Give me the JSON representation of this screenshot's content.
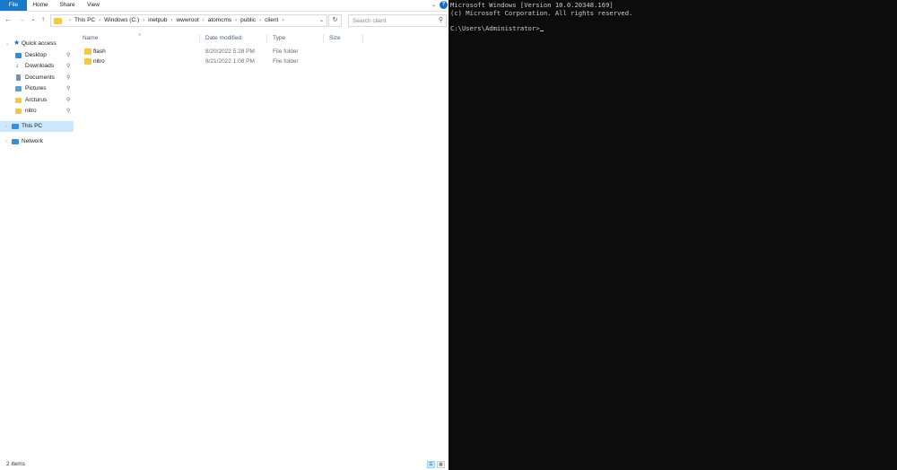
{
  "ribbon": {
    "tabs": [
      "File",
      "Home",
      "Share",
      "View"
    ],
    "help": "?"
  },
  "nav": {
    "address_crumbs": [
      "This PC",
      "Windows (C:)",
      "inetpub",
      "wwwroot",
      "atomcms",
      "public",
      "client"
    ],
    "search_placeholder": "Search client"
  },
  "sidebar": {
    "items": [
      {
        "label": "Quick access",
        "icon": "star-icon",
        "color": "#1a6fc4"
      },
      {
        "label": "Desktop",
        "icon": "desktop-icon",
        "color": "#2b8ce6",
        "pinned": true
      },
      {
        "label": "Downloads",
        "icon": "download-icon",
        "color": "#1a6fc4",
        "pinned": true
      },
      {
        "label": "Documents",
        "icon": "document-icon",
        "color": "#7a8ea8",
        "pinned": true
      },
      {
        "label": "Pictures",
        "icon": "picture-icon",
        "color": "#5aa0d8",
        "pinned": true
      },
      {
        "label": "Arcturus",
        "icon": "folder-icon",
        "color": "#f5c842",
        "pinned": true
      },
      {
        "label": "nitro",
        "icon": "folder-icon",
        "color": "#f5c842",
        "pinned": true
      },
      {
        "label": "This PC",
        "icon": "computer-icon",
        "color": "#3b8fd8",
        "selected": true
      },
      {
        "label": "Network",
        "icon": "network-icon",
        "color": "#3b8fd8"
      }
    ]
  },
  "content": {
    "columns": [
      "Name",
      "Date modified",
      "Type",
      "Size"
    ],
    "rows": [
      {
        "name": "flash",
        "date": "8/20/2022 5:28 PM",
        "type": "File folder",
        "size": ""
      },
      {
        "name": "nitro",
        "date": "8/21/2022 1:08 PM",
        "type": "File folder",
        "size": ""
      }
    ]
  },
  "status": {
    "items_count": "2 items"
  },
  "terminal": {
    "lines": [
      "Microsoft Windows [Version 10.0.20348.169]",
      "(c) Microsoft Corporation. All rights reserved.",
      "",
      "C:\\Users\\Administrator>"
    ]
  }
}
